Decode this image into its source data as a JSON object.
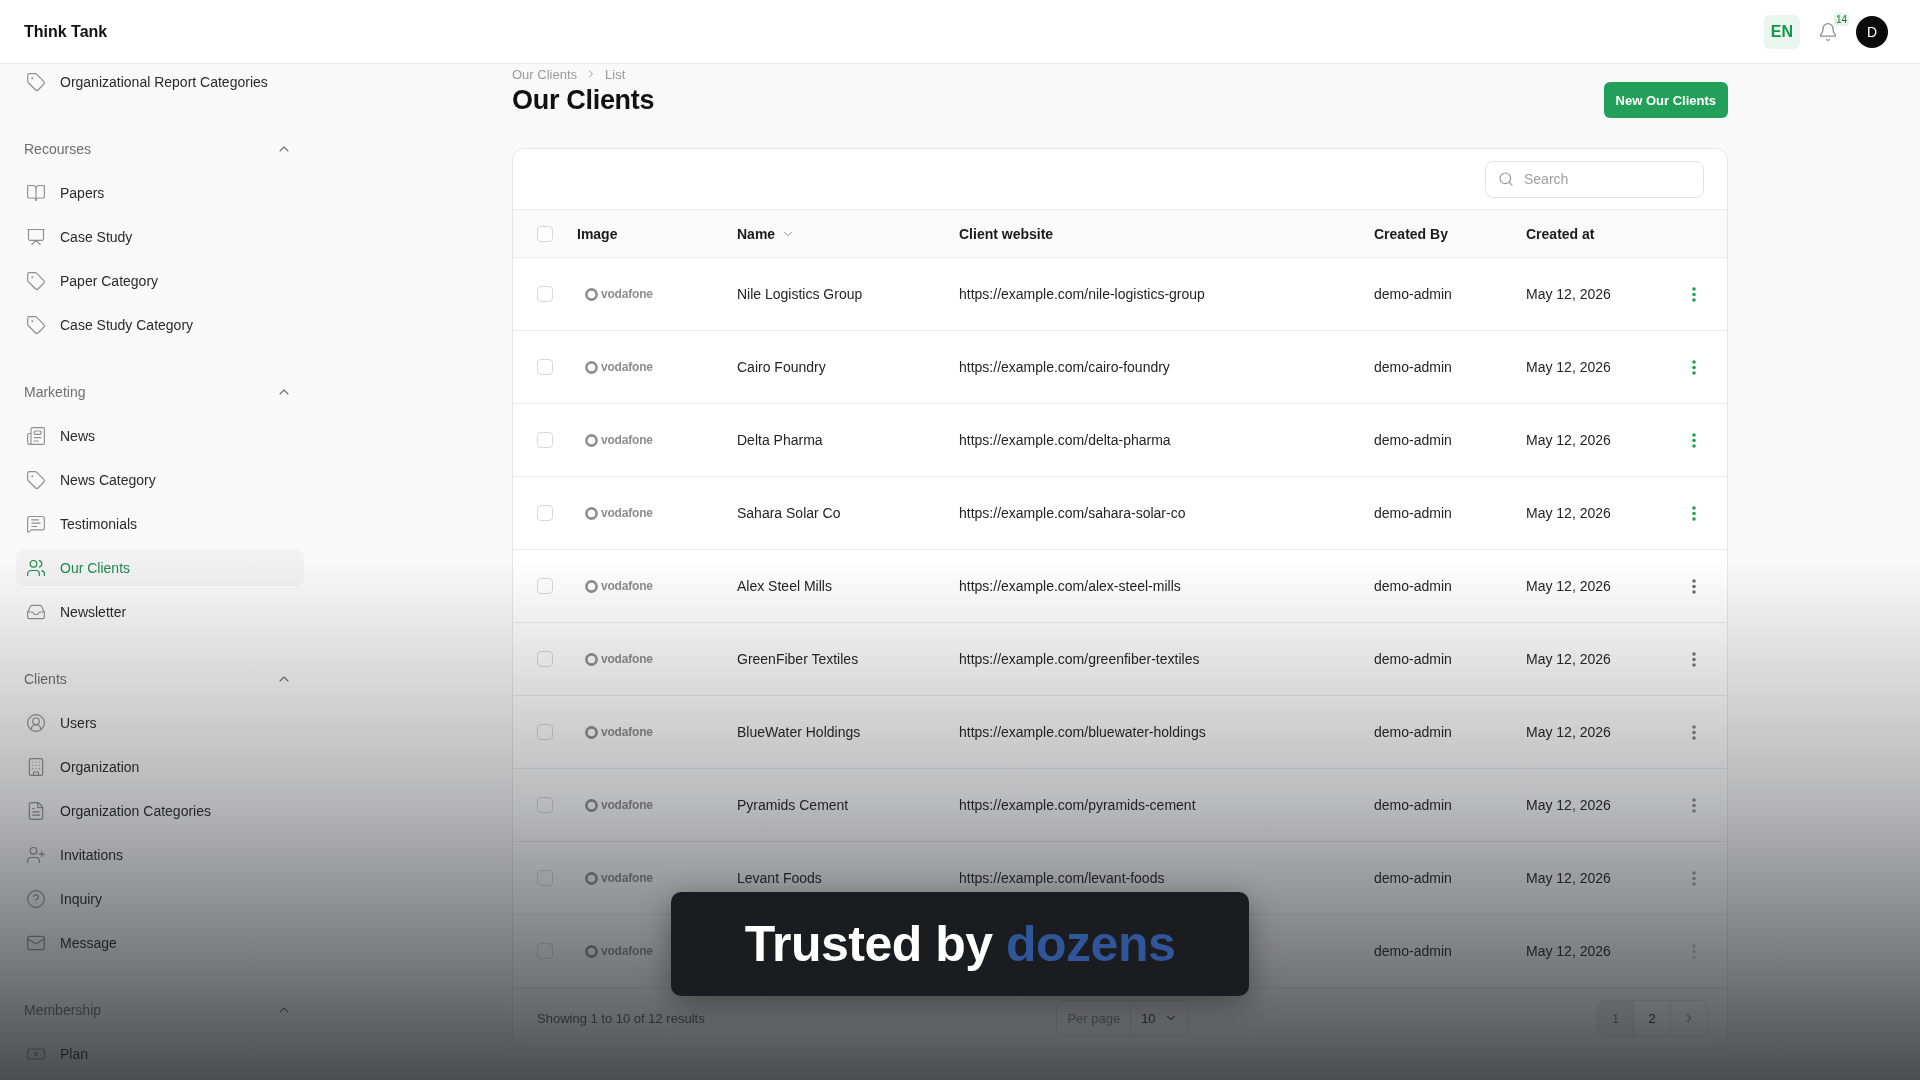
{
  "header": {
    "brand": "Think Tank",
    "language": "EN",
    "notifications": "14",
    "avatar": "D"
  },
  "sidebar": {
    "groups": [
      {
        "items": [
          {
            "label": "Organizational Report Categories",
            "selected": false
          }
        ]
      },
      {
        "title": "Recourses",
        "expanded": true,
        "items": [
          {
            "label": "Papers",
            "selected": false
          },
          {
            "label": "Case Study",
            "selected": false
          },
          {
            "label": "Paper Category",
            "selected": false
          },
          {
            "label": "Case Study Category",
            "selected": false
          }
        ]
      },
      {
        "title": "Marketing",
        "expanded": true,
        "items": [
          {
            "label": "News",
            "selected": false
          },
          {
            "label": "News Category",
            "selected": false
          },
          {
            "label": "Testimonials",
            "selected": false
          },
          {
            "label": "Our Clients",
            "selected": true
          },
          {
            "label": "Newsletter",
            "selected": false
          }
        ]
      },
      {
        "title": "Clients",
        "expanded": true,
        "items": [
          {
            "label": "Users",
            "selected": false
          },
          {
            "label": "Organization",
            "selected": false
          },
          {
            "label": "Organization Categories",
            "selected": false
          },
          {
            "label": "Invitations",
            "selected": false
          },
          {
            "label": "Inquiry",
            "selected": false
          },
          {
            "label": "Message",
            "selected": false
          }
        ]
      },
      {
        "title": "Membership",
        "expanded": true,
        "items": [
          {
            "label": "Plan",
            "selected": false
          }
        ]
      }
    ]
  },
  "breadcrumb": [
    {
      "label": "Our Clients"
    },
    {
      "label": "List"
    }
  ],
  "page": {
    "title": "Our Clients",
    "action": "New Our Clients"
  },
  "table": {
    "search": {
      "placeholder": "Search"
    },
    "select_all": {
      "checked": false
    },
    "columns": [
      {
        "label": "Image",
        "sortable": false
      },
      {
        "label": "Name",
        "sortable": true
      },
      {
        "label": "Client website",
        "sortable": false
      },
      {
        "label": "Created By",
        "sortable": false
      },
      {
        "label": "Created at",
        "sortable": false
      }
    ],
    "rows": [
      {
        "checked": false,
        "logo": "vodafone",
        "name": "Nile Logistics Group",
        "website": "https://example.com/nile-logistics-group",
        "created_by": "demo-admin",
        "created_at": "May 12, 2026",
        "menu": {
          "color": "#22a05a"
        }
      },
      {
        "checked": false,
        "logo": "vodafone",
        "name": "Cairo Foundry",
        "website": "https://example.com/cairo-foundry",
        "created_by": "demo-admin",
        "created_at": "May 12, 2026",
        "menu": {
          "color": "#22a05a"
        }
      },
      {
        "checked": false,
        "logo": "vodafone",
        "name": "Delta Pharma",
        "website": "https://example.com/delta-pharma",
        "created_by": "demo-admin",
        "created_at": "May 12, 2026",
        "menu": {
          "color": "#22a05a"
        }
      },
      {
        "checked": false,
        "logo": "vodafone",
        "name": "Sahara Solar Co",
        "website": "https://example.com/sahara-solar-co",
        "created_by": "demo-admin",
        "created_at": "May 12, 2026",
        "menu": {
          "color": "#22a05a"
        }
      },
      {
        "checked": false,
        "logo": "vodafone",
        "name": "Alex Steel Mills",
        "website": "https://example.com/alex-steel-mills",
        "created_by": "demo-admin",
        "created_at": "May 12, 2026",
        "menu": {
          "color": "#6b6b6b"
        }
      },
      {
        "checked": false,
        "logo": "vodafone",
        "name": "GreenFiber Textiles",
        "website": "https://example.com/greenfiber-textiles",
        "created_by": "demo-admin",
        "created_at": "May 12, 2026",
        "menu": {
          "color": "#6b6b6b"
        }
      },
      {
        "checked": false,
        "logo": "vodafone",
        "name": "BlueWater Holdings",
        "website": "https://example.com/bluewater-holdings",
        "created_by": "demo-admin",
        "created_at": "May 12, 2026",
        "menu": {
          "color": "#6b6b6b"
        }
      },
      {
        "checked": false,
        "logo": "vodafone",
        "name": "Pyramids Cement",
        "website": "https://example.com/pyramids-cement",
        "created_by": "demo-admin",
        "created_at": "May 12, 2026",
        "menu": {
          "color": "#6b6b6b"
        }
      },
      {
        "checked": false,
        "logo": "vodafone",
        "name": "Levant Foods",
        "website": "https://example.com/levant-foods",
        "created_by": "demo-admin",
        "created_at": "May 12, 2026",
        "menu": {
          "color": "#6b6b6b"
        }
      },
      {
        "checked": false,
        "logo": "vodafone",
        "created_by": "demo-admin",
        "created_at": "May 12, 2026",
        "menu": {
          "color": "#6b6b6b"
        }
      }
    ],
    "footer": {
      "summary": "Showing 1 to 10 of 12 results",
      "per_page_label": "Per page",
      "per_page": "10",
      "pages": [
        {
          "label": "1",
          "selected": true
        },
        {
          "label": "2",
          "selected": false
        }
      ]
    }
  },
  "caption": {
    "lead": "Trusted by",
    "highlight": "dozens"
  }
}
